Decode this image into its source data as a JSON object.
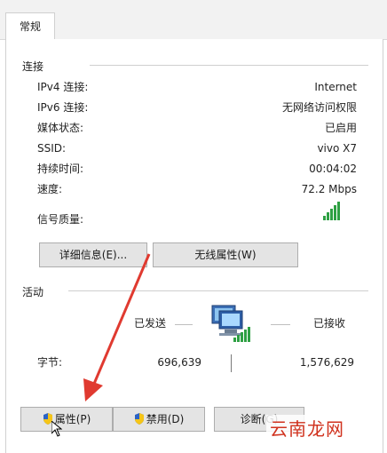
{
  "tab": {
    "label": "常规"
  },
  "connection": {
    "title": "连接",
    "rows": [
      {
        "label": "IPv4 连接:",
        "value": "Internet"
      },
      {
        "label": "IPv6 连接:",
        "value": "无网络访问权限"
      },
      {
        "label": "媒体状态:",
        "value": "已启用"
      },
      {
        "label": "SSID:",
        "value": "vivo X7"
      },
      {
        "label": "持续时间:",
        "value": "00:04:02"
      },
      {
        "label": "速度:",
        "value": "72.2 Mbps"
      }
    ],
    "signal_label": "信号质量:",
    "signal_level": 1.0,
    "details_button": "详细信息(E)...",
    "wireless_button": "无线属性(W)"
  },
  "activity": {
    "title": "活动",
    "sent_label": "已发送",
    "received_label": "已接收",
    "bytes_label": "字节:",
    "bytes_sent": "696,639",
    "bytes_received": "1,576,629"
  },
  "buttons": {
    "properties": "属性(P)",
    "disable": "禁用(D)",
    "diagnose": "诊断(G)"
  },
  "watermark": "云南龙网",
  "colors": {
    "signal": "#2ea043",
    "arrow": "#e03a30",
    "watermark": "#d0321e"
  }
}
